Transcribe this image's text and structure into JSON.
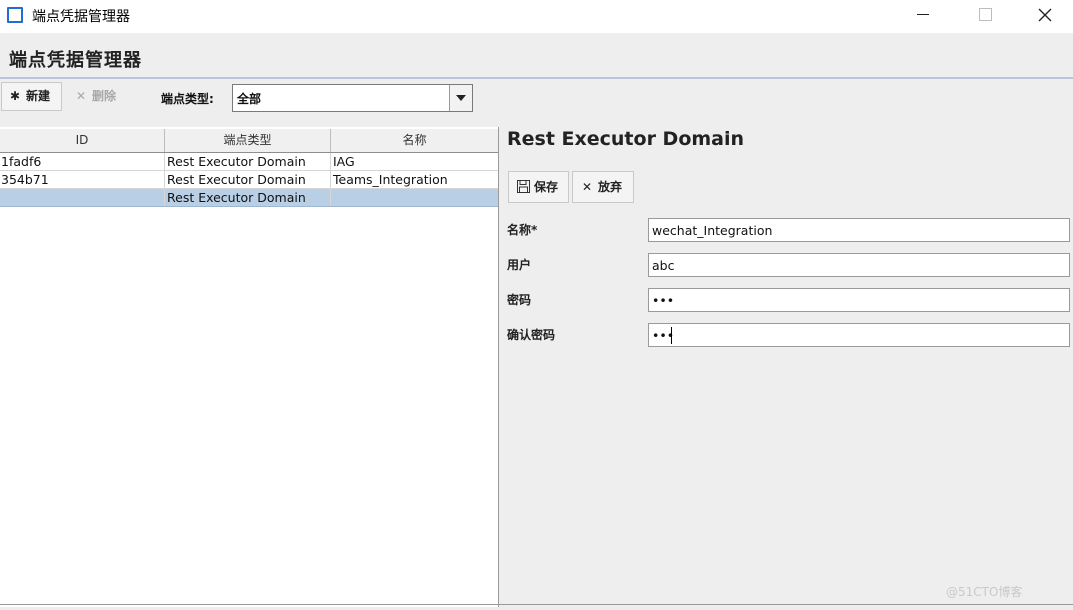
{
  "window": {
    "title": "端点凭据管理器",
    "minimize_label": "",
    "maximize_label": "",
    "close_label": ""
  },
  "header": {
    "title": "端点凭据管理器"
  },
  "toolbar": {
    "new_label": "新建",
    "delete_label": "删除",
    "filter_label": "端点类型:",
    "filter_value": "全部"
  },
  "table": {
    "columns": [
      "ID",
      "端点类型",
      "名称"
    ],
    "rows": [
      {
        "id": "1fadf6",
        "type": "Rest Executor Domain",
        "name": "IAG"
      },
      {
        "id": "354b71",
        "type": "Rest Executor Domain",
        "name": "Teams_Integration"
      },
      {
        "id": "",
        "type": "Rest Executor Domain",
        "name": ""
      }
    ],
    "selected_row": 2
  },
  "detail": {
    "title": "Rest Executor Domain",
    "save_label": "保存",
    "discard_label": "放弃",
    "fields": [
      {
        "label": "名称*",
        "value": "wechat_Integration"
      },
      {
        "label": "用户",
        "value": "abc"
      },
      {
        "label": "密码",
        "value": "•••"
      },
      {
        "label": "确认密码",
        "value": "•••"
      }
    ]
  },
  "watermark": "@51CTO博客",
  "colors": {
    "accent": "#1e6fd0",
    "selection": "#b8cfe5",
    "panel": "#eeeeee"
  },
  "icons": {
    "app": "app-window-icon",
    "new": "asterisk-icon",
    "delete": "x-icon",
    "save": "floppy-disk-icon",
    "discard": "x-icon"
  }
}
